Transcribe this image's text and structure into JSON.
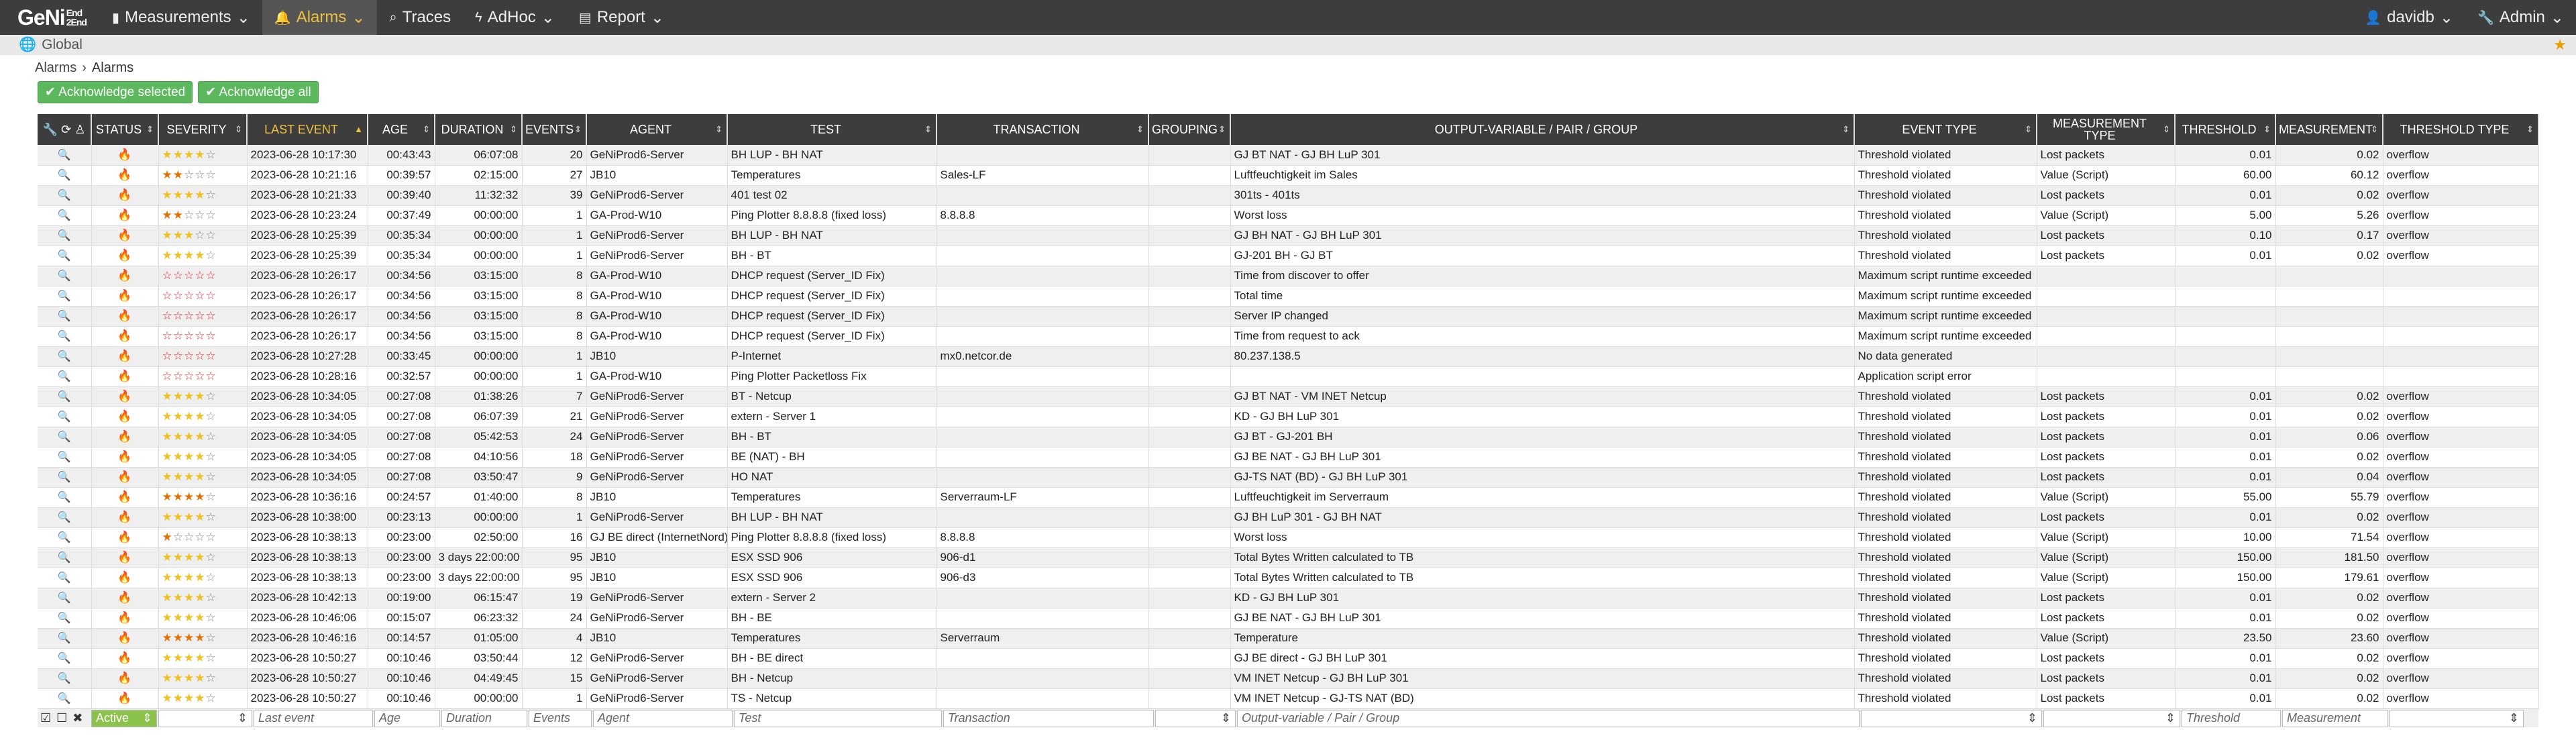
{
  "brand": {
    "name": "GeNi",
    "sup_top": "End",
    "sup_mid": "2",
    "sup_bot": "End"
  },
  "nav": [
    {
      "label": "Measurements",
      "icon": "bar-chart-icon"
    },
    {
      "label": "Alarms",
      "icon": "bell-icon"
    },
    {
      "label": "Traces",
      "icon": "search-icon"
    },
    {
      "label": "AdHoc",
      "icon": "bolt-icon"
    },
    {
      "label": "Report",
      "icon": "document-icon"
    }
  ],
  "user": {
    "label": "davidb"
  },
  "admin": {
    "label": "Admin"
  },
  "scope": "Global",
  "breadcrumb": {
    "root": "Alarms",
    "current": "Alarms"
  },
  "buttons": {
    "ack_selected": "Acknowledge selected",
    "ack_all": "Acknowledge all"
  },
  "columns": [
    "STATUS",
    "SEVERITY",
    "LAST EVENT",
    "AGE",
    "DURATION",
    "EVENTS",
    "AGENT",
    "TEST",
    "TRANSACTION",
    "GROUPING",
    "OUTPUT-VARIABLE / PAIR / GROUP",
    "EVENT TYPE",
    "MEASUREMENT TYPE",
    "THRESHOLD",
    "MEASUREMENT",
    "THRESHOLD TYPE"
  ],
  "rows": [
    {
      "stars": "yyyyg",
      "last": "2023-06-28 10:17:30",
      "age": "00:43:43",
      "dur": "06:07:08",
      "ev": "20",
      "agent": "GeNiProd6-Server",
      "test": "BH LUP - BH NAT",
      "tx": "",
      "grp": "",
      "out": "GJ BT NAT - GJ BH LuP 301",
      "etype": "Threshold violated",
      "mtype": "Lost packets",
      "thr": "0.01",
      "meas": "0.02",
      "ttype": "overflow"
    },
    {
      "stars": "ooggg",
      "last": "2023-06-28 10:21:16",
      "age": "00:39:57",
      "dur": "02:15:00",
      "ev": "27",
      "agent": "JB10",
      "test": "Temperatures",
      "tx": "Sales-LF",
      "grp": "",
      "out": "Luftfeuchtigkeit im Sales",
      "etype": "Threshold violated",
      "mtype": "Value (Script)",
      "thr": "60.00",
      "meas": "60.12",
      "ttype": "overflow"
    },
    {
      "stars": "yyyyg",
      "last": "2023-06-28 10:21:33",
      "age": "00:39:40",
      "dur": "11:32:32",
      "ev": "39",
      "agent": "GeNiProd6-Server",
      "test": "401 test 02",
      "tx": "",
      "grp": "",
      "out": "301ts - 401ts",
      "etype": "Threshold violated",
      "mtype": "Lost packets",
      "thr": "0.01",
      "meas": "0.02",
      "ttype": "overflow"
    },
    {
      "stars": "ooggg",
      "last": "2023-06-28 10:23:24",
      "age": "00:37:49",
      "dur": "00:00:00",
      "ev": "1",
      "agent": "GA-Prod-W10",
      "test": "Ping Plotter 8.8.8.8 (fixed loss)",
      "tx": "8.8.8.8",
      "grp": "",
      "out": "Worst loss",
      "etype": "Threshold violated",
      "mtype": "Value (Script)",
      "thr": "5.00",
      "meas": "5.26",
      "ttype": "overflow"
    },
    {
      "stars": "yyygg",
      "last": "2023-06-28 10:25:39",
      "age": "00:35:34",
      "dur": "00:00:00",
      "ev": "1",
      "agent": "GeNiProd6-Server",
      "test": "BH LUP - BH NAT",
      "tx": "",
      "grp": "",
      "out": "GJ BH NAT - GJ BH LuP 301",
      "etype": "Threshold violated",
      "mtype": "Lost packets",
      "thr": "0.10",
      "meas": "0.17",
      "ttype": "overflow"
    },
    {
      "stars": "yyyyg",
      "last": "2023-06-28 10:25:39",
      "age": "00:35:34",
      "dur": "00:00:00",
      "ev": "1",
      "agent": "GeNiProd6-Server",
      "test": "BH - BT",
      "tx": "",
      "grp": "",
      "out": "GJ-201 BH - GJ BT",
      "etype": "Threshold violated",
      "mtype": "Lost packets",
      "thr": "0.01",
      "meas": "0.02",
      "ttype": "overflow"
    },
    {
      "stars": "rrrrr",
      "last": "2023-06-28 10:26:17",
      "age": "00:34:56",
      "dur": "03:15:00",
      "ev": "8",
      "agent": "GA-Prod-W10",
      "test": "DHCP request (Server_ID Fix)",
      "tx": "",
      "grp": "",
      "out": "Time from discover to offer",
      "etype": "Maximum script runtime exceeded",
      "mtype": "",
      "thr": "",
      "meas": "",
      "ttype": ""
    },
    {
      "stars": "rrrrr",
      "last": "2023-06-28 10:26:17",
      "age": "00:34:56",
      "dur": "03:15:00",
      "ev": "8",
      "agent": "GA-Prod-W10",
      "test": "DHCP request (Server_ID Fix)",
      "tx": "",
      "grp": "",
      "out": "Total time",
      "etype": "Maximum script runtime exceeded",
      "mtype": "",
      "thr": "",
      "meas": "",
      "ttype": ""
    },
    {
      "stars": "rrrrr",
      "last": "2023-06-28 10:26:17",
      "age": "00:34:56",
      "dur": "03:15:00",
      "ev": "8",
      "agent": "GA-Prod-W10",
      "test": "DHCP request (Server_ID Fix)",
      "tx": "",
      "grp": "",
      "out": "Server IP changed",
      "etype": "Maximum script runtime exceeded",
      "mtype": "",
      "thr": "",
      "meas": "",
      "ttype": ""
    },
    {
      "stars": "rrrrr",
      "last": "2023-06-28 10:26:17",
      "age": "00:34:56",
      "dur": "03:15:00",
      "ev": "8",
      "agent": "GA-Prod-W10",
      "test": "DHCP request (Server_ID Fix)",
      "tx": "",
      "grp": "",
      "out": "Time from request to ack",
      "etype": "Maximum script runtime exceeded",
      "mtype": "",
      "thr": "",
      "meas": "",
      "ttype": ""
    },
    {
      "stars": "rrrrr",
      "last": "2023-06-28 10:27:28",
      "age": "00:33:45",
      "dur": "00:00:00",
      "ev": "1",
      "agent": "JB10",
      "test": "P-Internet",
      "tx": "mx0.netcor.de",
      "grp": "",
      "out": "80.237.138.5",
      "etype": "No data generated",
      "mtype": "",
      "thr": "",
      "meas": "",
      "ttype": ""
    },
    {
      "stars": "rrrrr",
      "last": "2023-06-28 10:28:16",
      "age": "00:32:57",
      "dur": "00:00:00",
      "ev": "1",
      "agent": "GA-Prod-W10",
      "test": "Ping Plotter Packetloss Fix",
      "tx": "",
      "grp": "",
      "out": "",
      "etype": "Application script error",
      "mtype": "",
      "thr": "",
      "meas": "",
      "ttype": ""
    },
    {
      "stars": "yyyyg",
      "last": "2023-06-28 10:34:05",
      "age": "00:27:08",
      "dur": "01:38:26",
      "ev": "7",
      "agent": "GeNiProd6-Server",
      "test": "BT - Netcup",
      "tx": "",
      "grp": "",
      "out": "GJ BT NAT - VM INET Netcup",
      "etype": "Threshold violated",
      "mtype": "Lost packets",
      "thr": "0.01",
      "meas": "0.02",
      "ttype": "overflow"
    },
    {
      "stars": "yyyyg",
      "last": "2023-06-28 10:34:05",
      "age": "00:27:08",
      "dur": "06:07:39",
      "ev": "21",
      "agent": "GeNiProd6-Server",
      "test": "extern - Server 1",
      "tx": "",
      "grp": "",
      "out": "KD - GJ BH LuP 301",
      "etype": "Threshold violated",
      "mtype": "Lost packets",
      "thr": "0.01",
      "meas": "0.02",
      "ttype": "overflow"
    },
    {
      "stars": "yyyyg",
      "last": "2023-06-28 10:34:05",
      "age": "00:27:08",
      "dur": "05:42:53",
      "ev": "24",
      "agent": "GeNiProd6-Server",
      "test": "BH - BT",
      "tx": "",
      "grp": "",
      "out": "GJ BT - GJ-201 BH",
      "etype": "Threshold violated",
      "mtype": "Lost packets",
      "thr": "0.01",
      "meas": "0.06",
      "ttype": "overflow"
    },
    {
      "stars": "yyyyg",
      "last": "2023-06-28 10:34:05",
      "age": "00:27:08",
      "dur": "04:10:56",
      "ev": "18",
      "agent": "GeNiProd6-Server",
      "test": "BE (NAT) - BH",
      "tx": "",
      "grp": "",
      "out": "GJ BE NAT - GJ BH LuP 301",
      "etype": "Threshold violated",
      "mtype": "Lost packets",
      "thr": "0.01",
      "meas": "0.02",
      "ttype": "overflow"
    },
    {
      "stars": "yyyyg",
      "last": "2023-06-28 10:34:05",
      "age": "00:27:08",
      "dur": "03:50:47",
      "ev": "9",
      "agent": "GeNiProd6-Server",
      "test": "HO NAT",
      "tx": "",
      "grp": "",
      "out": "GJ-TS NAT (BD) - GJ BH LuP 301",
      "etype": "Threshold violated",
      "mtype": "Lost packets",
      "thr": "0.01",
      "meas": "0.04",
      "ttype": "overflow"
    },
    {
      "stars": "oooog",
      "last": "2023-06-28 10:36:16",
      "age": "00:24:57",
      "dur": "01:40:00",
      "ev": "8",
      "agent": "JB10",
      "test": "Temperatures",
      "tx": "Serverraum-LF",
      "grp": "",
      "out": "Luftfeuchtigkeit im Serverraum",
      "etype": "Threshold violated",
      "mtype": "Value (Script)",
      "thr": "55.00",
      "meas": "55.79",
      "ttype": "overflow"
    },
    {
      "stars": "yyyyg",
      "last": "2023-06-28 10:38:00",
      "age": "00:23:13",
      "dur": "00:00:00",
      "ev": "1",
      "agent": "GeNiProd6-Server",
      "test": "BH LUP - BH NAT",
      "tx": "",
      "grp": "",
      "out": "GJ BH LuP 301 - GJ BH NAT",
      "etype": "Threshold violated",
      "mtype": "Lost packets",
      "thr": "0.01",
      "meas": "0.02",
      "ttype": "overflow"
    },
    {
      "stars": "oeggg",
      "last": "2023-06-28 10:38:13",
      "age": "00:23:00",
      "dur": "02:50:00",
      "ev": "16",
      "agent": "GJ BE direct (InternetNord)",
      "test": "Ping Plotter 8.8.8.8 (fixed loss)",
      "tx": "8.8.8.8",
      "grp": "",
      "out": "Worst loss",
      "etype": "Threshold violated",
      "mtype": "Value (Script)",
      "thr": "10.00",
      "meas": "71.54",
      "ttype": "overflow"
    },
    {
      "stars": "yyyyg",
      "last": "2023-06-28 10:38:13",
      "age": "00:23:00",
      "dur": "3 days 22:00:00",
      "ev": "95",
      "agent": "JB10",
      "test": "ESX SSD 906",
      "tx": "906-d1",
      "grp": "",
      "out": "Total Bytes Written calculated to TB",
      "etype": "Threshold violated",
      "mtype": "Value (Script)",
      "thr": "150.00",
      "meas": "181.50",
      "ttype": "overflow"
    },
    {
      "stars": "yyyyg",
      "last": "2023-06-28 10:38:13",
      "age": "00:23:00",
      "dur": "3 days 22:00:00",
      "ev": "95",
      "agent": "JB10",
      "test": "ESX SSD 906",
      "tx": "906-d3",
      "grp": "",
      "out": "Total Bytes Written calculated to TB",
      "etype": "Threshold violated",
      "mtype": "Value (Script)",
      "thr": "150.00",
      "meas": "179.61",
      "ttype": "overflow"
    },
    {
      "stars": "yyyyg",
      "last": "2023-06-28 10:42:13",
      "age": "00:19:00",
      "dur": "06:15:47",
      "ev": "19",
      "agent": "GeNiProd6-Server",
      "test": "extern - Server 2",
      "tx": "",
      "grp": "",
      "out": "KD - GJ BH LuP 301",
      "etype": "Threshold violated",
      "mtype": "Lost packets",
      "thr": "0.01",
      "meas": "0.02",
      "ttype": "overflow"
    },
    {
      "stars": "yyyyg",
      "last": "2023-06-28 10:46:06",
      "age": "00:15:07",
      "dur": "06:23:32",
      "ev": "24",
      "agent": "GeNiProd6-Server",
      "test": "BH - BE",
      "tx": "",
      "grp": "",
      "out": "GJ BE NAT - GJ BH LuP 301",
      "etype": "Threshold violated",
      "mtype": "Lost packets",
      "thr": "0.01",
      "meas": "0.02",
      "ttype": "overflow"
    },
    {
      "stars": "oooog",
      "last": "2023-06-28 10:46:16",
      "age": "00:14:57",
      "dur": "01:05:00",
      "ev": "4",
      "agent": "JB10",
      "test": "Temperatures",
      "tx": "Serverraum",
      "grp": "",
      "out": "Temperature",
      "etype": "Threshold violated",
      "mtype": "Value (Script)",
      "thr": "23.50",
      "meas": "23.60",
      "ttype": "overflow"
    },
    {
      "stars": "yyyyg",
      "last": "2023-06-28 10:50:27",
      "age": "00:10:46",
      "dur": "03:50:44",
      "ev": "12",
      "agent": "GeNiProd6-Server",
      "test": "BH - BE direct",
      "tx": "",
      "grp": "",
      "out": "GJ BE direct - GJ BH LuP 301",
      "etype": "Threshold violated",
      "mtype": "Lost packets",
      "thr": "0.01",
      "meas": "0.02",
      "ttype": "overflow"
    },
    {
      "stars": "yyyyg",
      "last": "2023-06-28 10:50:27",
      "age": "00:10:46",
      "dur": "04:49:45",
      "ev": "15",
      "agent": "GeNiProd6-Server",
      "test": "BH - Netcup",
      "tx": "",
      "grp": "",
      "out": "VM INET Netcup - GJ BH LuP 301",
      "etype": "Threshold violated",
      "mtype": "Lost packets",
      "thr": "0.01",
      "meas": "0.02",
      "ttype": "overflow"
    },
    {
      "stars": "yyyyg",
      "last": "2023-06-28 10:50:27",
      "age": "00:10:46",
      "dur": "00:00:00",
      "ev": "1",
      "agent": "GeNiProd6-Server",
      "test": "TS - Netcup",
      "tx": "",
      "grp": "",
      "out": "VM INET Netcup - GJ-TS NAT (BD)",
      "etype": "Threshold violated",
      "mtype": "Lost packets",
      "thr": "0.01",
      "meas": "0.02",
      "ttype": "overflow"
    }
  ],
  "filters": {
    "status": "Active",
    "last_event": "Last event",
    "age": "Age",
    "duration": "Duration",
    "events": "Events",
    "agent": "Agent",
    "test": "Test",
    "transaction": "Transaction",
    "output": "Output-variable / Pair / Group",
    "threshold": "Threshold",
    "measurement": "Measurement"
  },
  "colors": {
    "topbar": "#3d3d3d",
    "accent": "#f0c040",
    "success": "#5cb85c",
    "fire": "#d33333"
  }
}
